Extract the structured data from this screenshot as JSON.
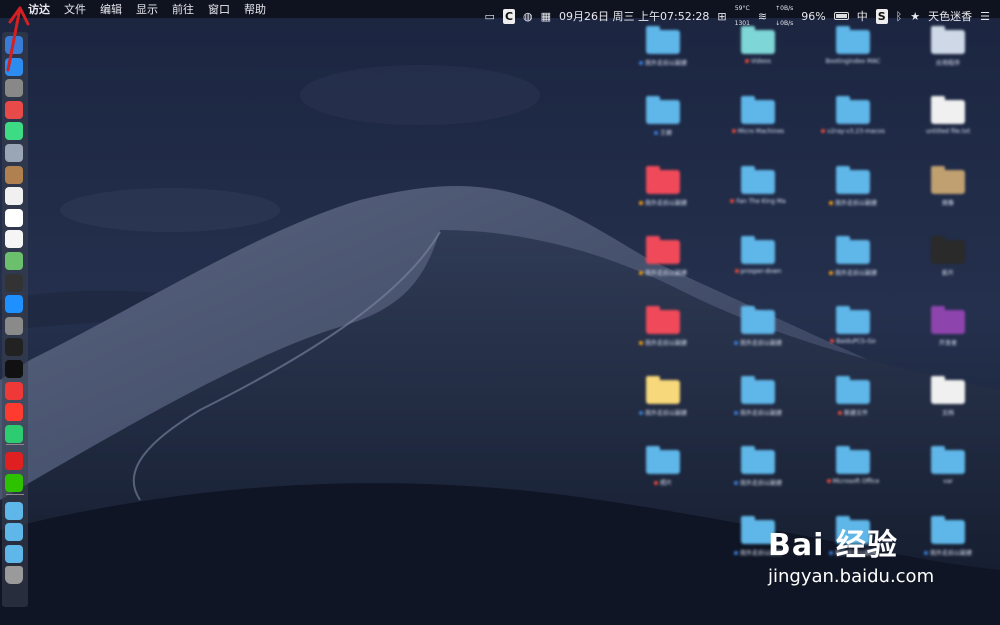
{
  "menubar": {
    "apple": "",
    "items": [
      "访达",
      "文件",
      "编辑",
      "显示",
      "前往",
      "窗口",
      "帮助"
    ],
    "temperature": "59°C",
    "fan": "1301",
    "datetime": "09月26日 周三 上午07:52:28",
    "net_up": "↑0B/s",
    "net_down": "↓0B/s",
    "battery": "96%",
    "input_method": "中",
    "user": "天色迷香"
  },
  "desktop": {
    "items": [
      {
        "label": "我外走后以副建",
        "color": "#5fb6e8",
        "dot": "#3b7dd8"
      },
      {
        "label": "Videos",
        "color": "#7fd6d6",
        "dot": "#e74c3c"
      },
      {
        "label": "Bootingindex MAC",
        "color": "#5fb6e8",
        "dot": ""
      },
      {
        "label": "应用程序",
        "color": "#cfd8e6",
        "dot": ""
      },
      {
        "label": "王卿",
        "color": "#5fb6e8",
        "dot": "#3b7dd8"
      },
      {
        "label": "Micro Machines",
        "color": "#5fb6e8",
        "dot": "#e74c3c"
      },
      {
        "label": "v2ray-v3.23-macos",
        "color": "#5fb6e8",
        "dot": "#e74c3c"
      },
      {
        "label": "untitled file.txt",
        "color": "#f0f0f0",
        "dot": ""
      },
      {
        "label": "我外走后以副建",
        "color": "#f04a5a",
        "dot": "#f39c12"
      },
      {
        "label": "Fan The King Ma",
        "color": "#5fb6e8",
        "dot": "#e74c3c"
      },
      {
        "label": "我外走后以副建",
        "color": "#5fb6e8",
        "dot": "#f39c12"
      },
      {
        "label": "图像",
        "color": "#c0a070",
        "dot": ""
      },
      {
        "label": "我外走后以副建",
        "color": "#f04a5a",
        "dot": "#f39c12"
      },
      {
        "label": "prosper-down",
        "color": "#5fb6e8",
        "dot": "#e74c3c"
      },
      {
        "label": "我外走后以副建",
        "color": "#5fb6e8",
        "dot": "#f39c12"
      },
      {
        "label": "影片",
        "color": "#2a2a2a",
        "dot": ""
      },
      {
        "label": "我外走后以副建",
        "color": "#f04a5a",
        "dot": "#f39c12"
      },
      {
        "label": "我外走后以副建",
        "color": "#5fb6e8",
        "dot": "#3b7dd8"
      },
      {
        "label": "BaiduPCS-Go",
        "color": "#5fb6e8",
        "dot": "#e74c3c"
      },
      {
        "label": "开发者",
        "color": "#8e44ad",
        "dot": ""
      },
      {
        "label": "我外走后以副建",
        "color": "#f7d87a",
        "dot": "#3b7dd8"
      },
      {
        "label": "我外走后以副建",
        "color": "#5fb6e8",
        "dot": "#3b7dd8"
      },
      {
        "label": "新建文件",
        "color": "#5fb6e8",
        "dot": "#e74c3c"
      },
      {
        "label": "文档",
        "color": "#f0f0f0",
        "dot": ""
      },
      {
        "label": "照片",
        "color": "#5fb6e8",
        "dot": "#e74c3c"
      },
      {
        "label": "我外走后以副建",
        "color": "#5fb6e8",
        "dot": "#3b7dd8"
      },
      {
        "label": "Microsoft Office",
        "color": "#5fb6e8",
        "dot": "#e74c3c"
      },
      {
        "label": "var",
        "color": "#5fb6e8",
        "dot": ""
      },
      {
        "label": "",
        "color": "",
        "dot": ""
      },
      {
        "label": "我外走后以副建",
        "color": "#5fb6e8",
        "dot": "#3b7dd8"
      },
      {
        "label": "我外走后以副建",
        "color": "#5fb6e8",
        "dot": "#3b7dd8"
      },
      {
        "label": "我外走后以副建",
        "color": "#5fb6e8",
        "dot": "#3b7dd8"
      }
    ]
  },
  "dock": {
    "icons": [
      {
        "name": "finder-icon",
        "color": "#3a7bd5"
      },
      {
        "name": "safari-icon",
        "color": "#2d8cf0"
      },
      {
        "name": "launchpad-icon",
        "color": "#888"
      },
      {
        "name": "app-red-icon",
        "color": "#e84a4a"
      },
      {
        "name": "android-icon",
        "color": "#3ddc84"
      },
      {
        "name": "preview-icon",
        "color": "#9aa5b5"
      },
      {
        "name": "notes-icon",
        "color": "#b08050"
      },
      {
        "name": "calendar-icon",
        "color": "#f0f0f0"
      },
      {
        "name": "reminders-icon",
        "color": "#ffffff"
      },
      {
        "name": "list-icon",
        "color": "#f5f5f5"
      },
      {
        "name": "maps-icon",
        "color": "#6cbf6c"
      },
      {
        "name": "terminal-icon",
        "color": "#333"
      },
      {
        "name": "appstore-icon",
        "color": "#1e90ff"
      },
      {
        "name": "system-prefs-icon",
        "color": "#8a8a8a"
      },
      {
        "name": "activity-monitor-icon",
        "color": "#222"
      },
      {
        "name": "terminal2-icon",
        "color": "#111"
      },
      {
        "name": "vivaldi-icon",
        "color": "#ef3939"
      },
      {
        "name": "yandex-icon",
        "color": "#ff3b30"
      },
      {
        "name": "app-green-icon",
        "color": "#2ecc71"
      },
      {
        "name": "netease-icon",
        "color": "#e02020"
      },
      {
        "name": "wechat-icon",
        "color": "#2dc100"
      },
      {
        "name": "folder1-icon",
        "color": "#5fb6e8"
      },
      {
        "name": "folder2-icon",
        "color": "#5fb6e8"
      },
      {
        "name": "folder3-icon",
        "color": "#5fb6e8"
      },
      {
        "name": "trash-icon",
        "color": "#9a9a9a"
      }
    ]
  },
  "watermark": {
    "brand": "Bai 经验",
    "url": "jingyan.baidu.com"
  },
  "colors": {
    "arrow": "#d42020"
  }
}
